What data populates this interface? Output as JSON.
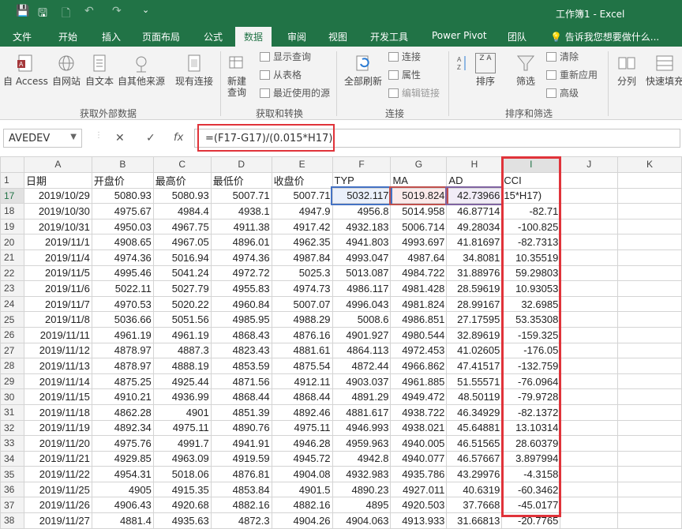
{
  "titlebar": {
    "doc_title": "工作簿1 - Excel",
    "qa_save": "💾",
    "qa_save2": "🖫",
    "qa_new": "🗋",
    "qa_undo": "↶",
    "qa_redo": "↷",
    "qa_more": "⌄"
  },
  "tabs": [
    "文件",
    "开始",
    "插入",
    "页面布局",
    "公式",
    "数据",
    "审阅",
    "视图",
    "开发工具",
    "Power Pivot",
    "团队"
  ],
  "active_tab": "数据",
  "tellme": "💡 告诉我您想要做什么...",
  "ribbon": {
    "get_external": {
      "title": "获取外部数据",
      "buttons": [
        "自 Access",
        "自网站",
        "自文本",
        "自其他来源",
        "现有连接"
      ]
    },
    "get_transform": {
      "title": "获取和转换",
      "new_query": "新建\n查询",
      "small": [
        "显示查询",
        "从表格",
        "最近使用的源"
      ]
    },
    "connections": {
      "title": "连接",
      "refresh_all": "全部刷新",
      "small": [
        "连接",
        "属性",
        "编辑链接"
      ]
    },
    "sort_filter": {
      "title": "排序和筛选",
      "sort": "排序",
      "filter": "筛选",
      "small": [
        "清除",
        "重新应用",
        "高级"
      ],
      "za": "Z A"
    },
    "tools": {
      "split": "分列",
      "flash": "快速填充"
    }
  },
  "formula_bar": {
    "name_box": "AVEDEV",
    "cancel": "✕",
    "enter": "✓",
    "fx": "fx",
    "formula": "=(F17-G17)/(0.015*H17)"
  },
  "grid": {
    "columns": [
      "A",
      "B",
      "C",
      "D",
      "E",
      "F",
      "G",
      "H",
      "I",
      "J",
      "K"
    ],
    "header_row": [
      "日期",
      "开盘价",
      "最高价",
      "最低价",
      "收盘价",
      "TYP",
      "MA",
      "AD",
      "CCI",
      "",
      ""
    ],
    "rows": [
      {
        "n": "17",
        "c": [
          "2019/10/29",
          "5080.93",
          "5080.93",
          "5007.71",
          "5007.71",
          "5032.117",
          "5019.824",
          "42.73966",
          "15*H17)",
          "",
          ""
        ]
      },
      {
        "n": "18",
        "c": [
          "2019/10/30",
          "4975.67",
          "4984.4",
          "4938.1",
          "4947.9",
          "4956.8",
          "5014.958",
          "46.87714",
          "-82.71",
          "",
          ""
        ]
      },
      {
        "n": "19",
        "c": [
          "2019/10/31",
          "4950.03",
          "4967.75",
          "4911.38",
          "4917.42",
          "4932.183",
          "5006.714",
          "49.28034",
          "-100.825",
          "",
          ""
        ]
      },
      {
        "n": "20",
        "c": [
          "2019/11/1",
          "4908.65",
          "4967.05",
          "4896.01",
          "4962.35",
          "4941.803",
          "4993.697",
          "41.81697",
          "-82.7313",
          "",
          ""
        ]
      },
      {
        "n": "21",
        "c": [
          "2019/11/4",
          "4974.36",
          "5016.94",
          "4974.36",
          "4987.84",
          "4993.047",
          "4987.64",
          "34.8081",
          "10.35519",
          "",
          ""
        ]
      },
      {
        "n": "22",
        "c": [
          "2019/11/5",
          "4995.46",
          "5041.24",
          "4972.72",
          "5025.3",
          "5013.087",
          "4984.722",
          "31.88976",
          "59.29803",
          "",
          ""
        ]
      },
      {
        "n": "23",
        "c": [
          "2019/11/6",
          "5022.11",
          "5027.79",
          "4955.83",
          "4974.73",
          "4986.117",
          "4981.428",
          "28.59619",
          "10.93053",
          "",
          ""
        ]
      },
      {
        "n": "24",
        "c": [
          "2019/11/7",
          "4970.53",
          "5020.22",
          "4960.84",
          "5007.07",
          "4996.043",
          "4981.824",
          "28.99167",
          "32.6985",
          "",
          ""
        ]
      },
      {
        "n": "25",
        "c": [
          "2019/11/8",
          "5036.66",
          "5051.56",
          "4985.95",
          "4988.29",
          "5008.6",
          "4986.851",
          "27.17595",
          "53.35308",
          "",
          ""
        ]
      },
      {
        "n": "26",
        "c": [
          "2019/11/11",
          "4961.19",
          "4961.19",
          "4868.43",
          "4876.16",
          "4901.927",
          "4980.544",
          "32.89619",
          "-159.325",
          "",
          ""
        ]
      },
      {
        "n": "27",
        "c": [
          "2019/11/12",
          "4878.97",
          "4887.3",
          "4823.43",
          "4881.61",
          "4864.113",
          "4972.453",
          "41.02605",
          "-176.05",
          "",
          ""
        ]
      },
      {
        "n": "28",
        "c": [
          "2019/11/13",
          "4878.97",
          "4888.19",
          "4853.59",
          "4875.54",
          "4872.44",
          "4966.862",
          "47.41517",
          "-132.759",
          "",
          ""
        ]
      },
      {
        "n": "29",
        "c": [
          "2019/11/14",
          "4875.25",
          "4925.44",
          "4871.56",
          "4912.11",
          "4903.037",
          "4961.885",
          "51.55571",
          "-76.0964",
          "",
          ""
        ]
      },
      {
        "n": "30",
        "c": [
          "2019/11/15",
          "4910.21",
          "4936.99",
          "4868.44",
          "4868.44",
          "4891.29",
          "4949.472",
          "48.50119",
          "-79.9728",
          "",
          ""
        ]
      },
      {
        "n": "31",
        "c": [
          "2019/11/18",
          "4862.28",
          "4901",
          "4851.39",
          "4892.46",
          "4881.617",
          "4938.722",
          "46.34929",
          "-82.1372",
          "",
          ""
        ]
      },
      {
        "n": "32",
        "c": [
          "2019/11/19",
          "4892.34",
          "4975.11",
          "4890.76",
          "4975.11",
          "4946.993",
          "4938.021",
          "45.64881",
          "13.10314",
          "",
          ""
        ]
      },
      {
        "n": "33",
        "c": [
          "2019/11/20",
          "4975.76",
          "4991.7",
          "4941.91",
          "4946.28",
          "4959.963",
          "4940.005",
          "46.51565",
          "28.60379",
          "",
          ""
        ]
      },
      {
        "n": "34",
        "c": [
          "2019/11/21",
          "4929.85",
          "4963.09",
          "4919.59",
          "4945.72",
          "4942.8",
          "4940.077",
          "46.57667",
          "3.897994",
          "",
          ""
        ]
      },
      {
        "n": "35",
        "c": [
          "2019/11/22",
          "4954.31",
          "5018.06",
          "4876.81",
          "4904.08",
          "4932.983",
          "4935.786",
          "43.29976",
          "-4.3158",
          "",
          ""
        ]
      },
      {
        "n": "36",
        "c": [
          "2019/11/25",
          "4905",
          "4915.35",
          "4853.84",
          "4901.5",
          "4890.23",
          "4927.011",
          "40.6319",
          "-60.3462",
          "",
          ""
        ]
      },
      {
        "n": "37",
        "c": [
          "2019/11/26",
          "4906.43",
          "4920.68",
          "4882.16",
          "4882.16",
          "4895",
          "4920.503",
          "37.7668",
          "-45.0177",
          "",
          ""
        ]
      },
      {
        "n": "38",
        "c": [
          "2019/11/27",
          "4881.4",
          "4935.63",
          "4872.3",
          "4904.26",
          "4904.063",
          "4913.933",
          "31.66813",
          "-20.7765",
          "",
          ""
        ]
      }
    ]
  }
}
